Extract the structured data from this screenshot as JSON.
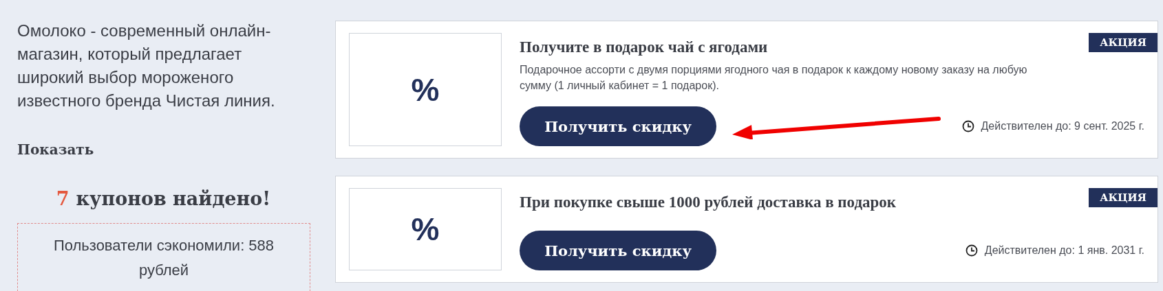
{
  "store_description": {
    "text": "Омолоко - современный онлайн-магазин, который предлагает широкий выбор мороженого известного бренда Чистая линия.",
    "toggle": "Показать"
  },
  "coupon_count": {
    "number": "7",
    "label": "купонов найдено!"
  },
  "savings": {
    "text": "Пользователи сэкономили: 588 рублей"
  },
  "coupons": [
    {
      "image_symbol": "%",
      "title": "Получите в подарок чай с ягодами",
      "description": "Подарочное ассорти с двумя порциями ягодного чая в подарок к каждому новому заказу на любую сумму (1 личный кабинет = 1 подарок).",
      "button": "Получить скидку",
      "badge": "АКЦИЯ",
      "validity": "Действителен до: 9 сент. 2025 г.",
      "annotated": true
    },
    {
      "image_symbol": "%",
      "title": "При покупке свыше 1000 рублей доставка в подарок",
      "button": "Получить скидку",
      "badge": "АКЦИЯ",
      "validity": "Действителен до: 1 янв. 2031 г.",
      "annotated": false
    }
  ]
}
